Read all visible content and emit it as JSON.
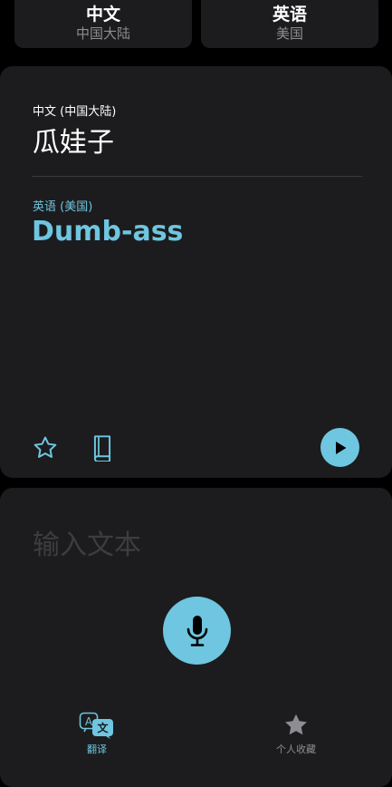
{
  "languages": {
    "source": {
      "name": "中文",
      "region": "中国大陆"
    },
    "target": {
      "name": "英语",
      "region": "美国"
    }
  },
  "translation": {
    "source_label": "中文 (中国大陆)",
    "source_text": "瓜娃子",
    "target_label": "英语 (美国)",
    "target_text": "Dumb-ass"
  },
  "result_actions": {
    "favorite_icon": "star-outline-icon",
    "dictionary_icon": "book-icon",
    "play_icon": "play-icon"
  },
  "input": {
    "placeholder": "输入文本",
    "mic_icon": "microphone-icon"
  },
  "tabs": [
    {
      "label": "翻译",
      "icon": "translate-icon",
      "active": true
    },
    {
      "label": "个人收藏",
      "icon": "star-filled-icon",
      "active": false
    }
  ],
  "colors": {
    "accent": "#6ec6e0",
    "card": "#1c1c1e",
    "background": "#000000",
    "secondary_text": "#8d8d92",
    "placeholder": "#3d3d40"
  }
}
